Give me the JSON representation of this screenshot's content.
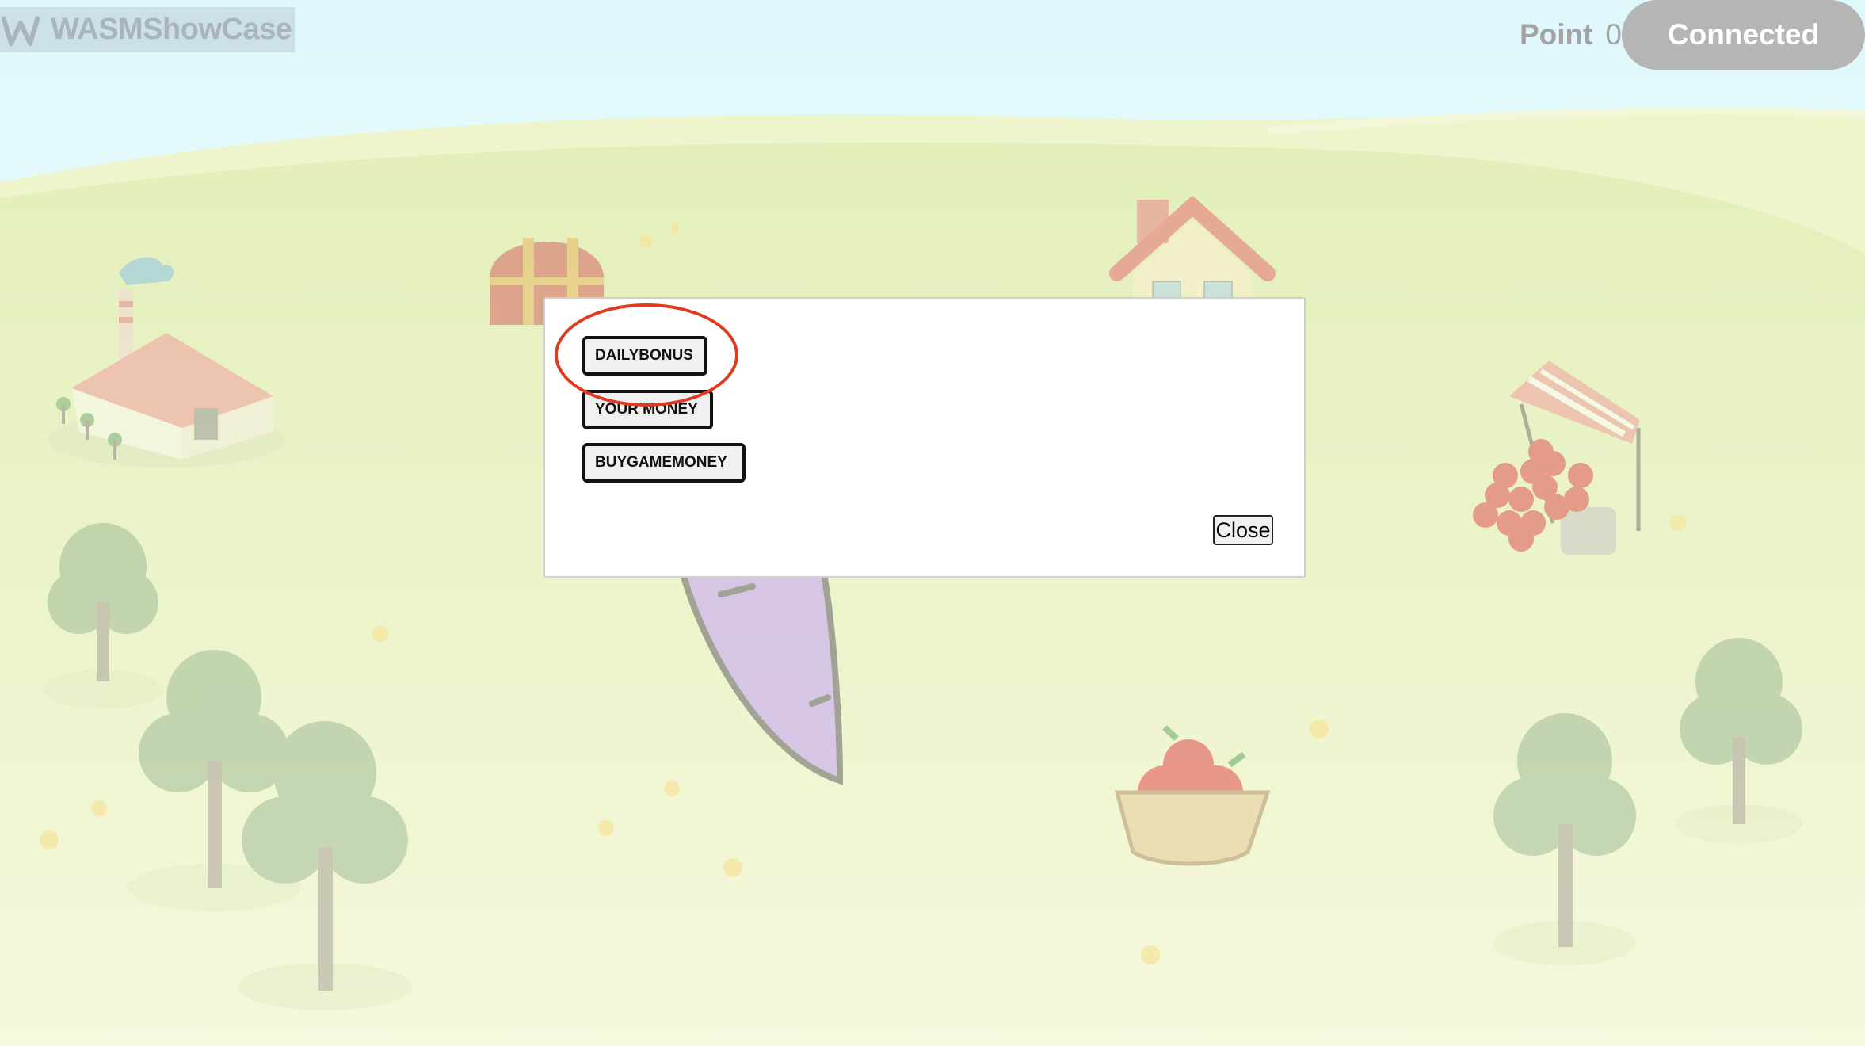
{
  "header": {
    "logo_text": "WASMShowCase",
    "points_label": "Point",
    "points_value": "0",
    "connect_button": "Connected"
  },
  "dialog": {
    "buttons": [
      "DAILYBONUS",
      "YOUR MONEY",
      "BUYGAMEMONEY"
    ],
    "close_label": "Close"
  },
  "colors": {
    "sky": "#e0f8fc",
    "grass": "#eef4cf",
    "highlight": "#e03a1e",
    "connected_bg": "#b5b5b5"
  }
}
